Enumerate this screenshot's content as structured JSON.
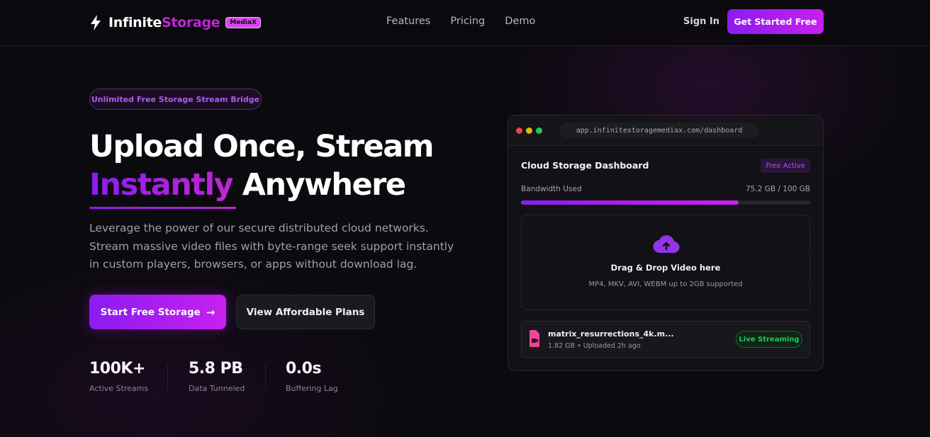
{
  "nav": {
    "logo_part1": "Infinite",
    "logo_part2": "Storage",
    "logo_badge": "MediaX",
    "links": [
      "Features",
      "Pricing",
      "Demo"
    ],
    "sign_in": "Sign In",
    "cta": "Get Started Free"
  },
  "hero": {
    "pill": "Unlimited Free Storage Stream Bridge",
    "title_line1": "Upload Once, Stream",
    "title_highlight": "Instantly",
    "title_rest": "Anywhere",
    "lead": "Leverage the power of our secure distributed cloud networks. Stream massive video files with byte-range seek support instantly in custom players, browsers, or apps without download lag.",
    "primary_button": "Start Free Storage",
    "primary_arrow": "→",
    "secondary_button": "View Affordable Plans",
    "stats": [
      {
        "value": "100K+",
        "label": "Active Streams"
      },
      {
        "value": "5.8 PB",
        "label": "Data Tunneled"
      },
      {
        "value": "0.0s",
        "label": "Buffering Lag"
      }
    ]
  },
  "dashboard": {
    "url": "app.infinitestoragemediax.com/dashboard",
    "title": "Cloud Storage Dashboard",
    "badge": "Free Active",
    "bandwidth_label": "Bandwidth Used",
    "bandwidth_value": "75.2 GB / 100 GB",
    "bandwidth_fraction": 0.752,
    "dropzone_title": "Drag & Drop Video here",
    "dropzone_sub": "MP4, MKV, AVI, WEBM up to 2GB supported",
    "file": {
      "name": "matrix_resurrections_4k.m...",
      "meta": "1.82 GB • Uploaded 2h ago",
      "status": "Live Streaming"
    }
  },
  "colors": {
    "accent": "#8b1cf0",
    "accent2": "#c026d3",
    "live": "#22c55e",
    "dot_red": "#ef4444",
    "dot_yellow": "#eab308",
    "dot_green": "#22c55e"
  },
  "icons": [
    "bolt-icon",
    "arrow-right-icon",
    "cloud-upload-icon",
    "file-video-icon"
  ]
}
